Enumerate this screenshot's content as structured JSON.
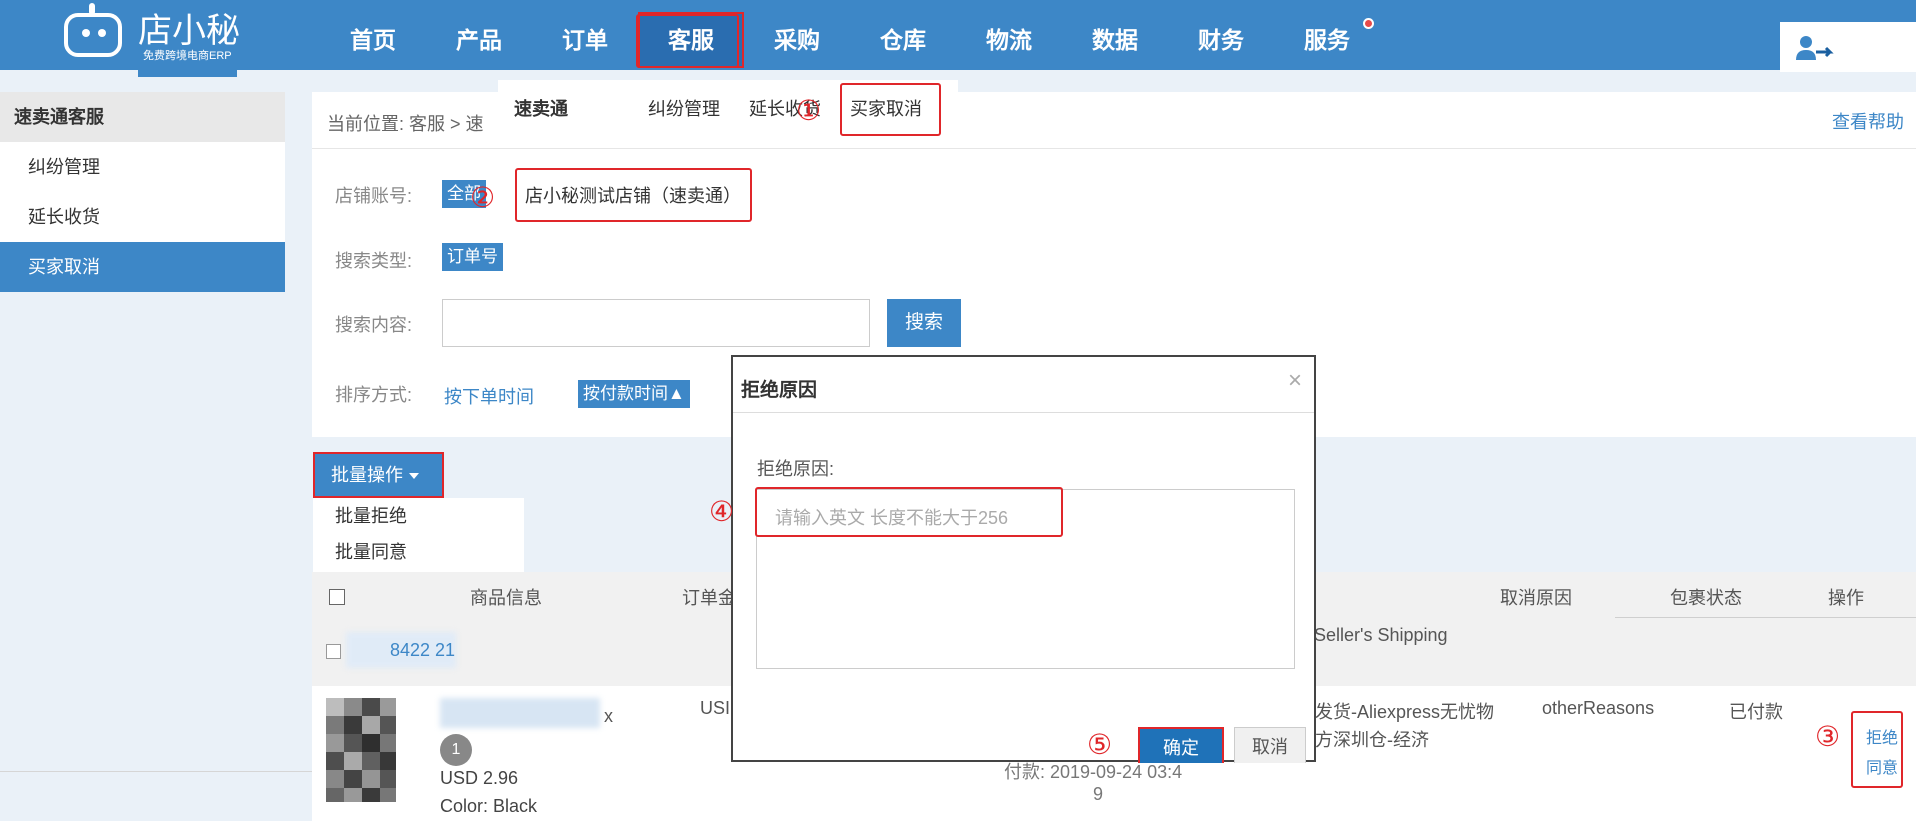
{
  "logo": {
    "name": "店小秘",
    "tagline": "免费跨境电商ERP"
  },
  "nav": [
    {
      "label": "首页"
    },
    {
      "label": "产品"
    },
    {
      "label": "订单"
    },
    {
      "label": "客服"
    },
    {
      "label": "采购"
    },
    {
      "label": "仓库"
    },
    {
      "label": "物流"
    },
    {
      "label": "数据"
    },
    {
      "label": "财务"
    },
    {
      "label": "服务"
    }
  ],
  "submenu": {
    "title": "速卖通",
    "items": [
      "纠纷管理",
      "延长收货",
      "买家取消"
    ]
  },
  "sidebar": {
    "header": "速卖通客服",
    "items": [
      "纠纷管理",
      "延长收货",
      "买家取消"
    ],
    "active": "买家取消"
  },
  "breadcrumb": "当前位置:  客服 > 速",
  "help": "查看帮助",
  "filters": {
    "shop_label": "店铺账号:",
    "shop_all": "全部",
    "shop_name": "店小秘测试店铺（速卖通）",
    "type_label": "搜索类型:",
    "type_value": "订单号",
    "content_label": "搜索内容:",
    "search_button": "搜索",
    "sort_label": "排序方式:",
    "sort_order_time": "按下单时间",
    "sort_pay_time": "按付款时间▲"
  },
  "batch": {
    "button": "批量操作",
    "items": [
      "批量拒绝",
      "批量同意"
    ]
  },
  "table": {
    "headers": [
      "商品信息",
      "订单金",
      "取消原因",
      "包裹状态",
      "操作"
    ],
    "order_no": "8422      21",
    "shipping_header": "Seller's Shipping",
    "row": {
      "currency": "USI",
      "x_mark": "x",
      "qty": "1",
      "price": "USD 2.96",
      "color": "Color:  Black",
      "shipping_1": "发货-Aliexpress无忧物",
      "shipping_2": "方深圳仓-经济",
      "reason": "otherReasons",
      "status": "已付款",
      "paid_time_1": "付款: 2019-09-24 03:4",
      "paid_time_2": "9",
      "op_reject": "拒绝",
      "op_agree": "同意"
    }
  },
  "modal": {
    "title": "拒绝原因",
    "close": "×",
    "label": "拒绝原因:",
    "placeholder": "请输入英文 长度不能大于256",
    "ok": "确定",
    "cancel": "取消"
  },
  "steps": [
    "①",
    "②",
    "③",
    "④",
    "⑤"
  ],
  "colors": {
    "primary": "#3d87c7",
    "highlight": "#e0262a"
  }
}
